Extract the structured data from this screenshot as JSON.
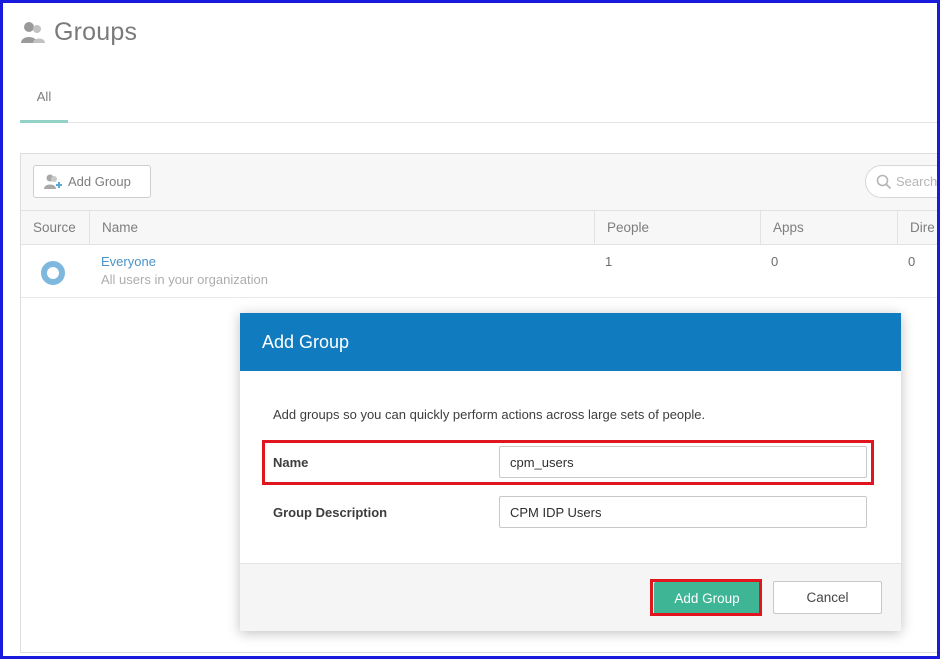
{
  "header": {
    "title": "Groups",
    "icon": "group-icon"
  },
  "tabs": [
    {
      "label": "All",
      "active": true
    }
  ],
  "toolbar": {
    "add_group_label": "Add Group",
    "search_placeholder": "Search"
  },
  "table": {
    "columns": [
      "Source",
      "Name",
      "People",
      "Apps",
      "Dire"
    ],
    "rows": [
      {
        "source_icon": "okta-ring-icon",
        "name": "Everyone",
        "description": "All users in your organization",
        "people": "1",
        "apps": "0",
        "directories": "0"
      }
    ]
  },
  "modal": {
    "title": "Add Group",
    "intro": "Add groups so you can quickly perform actions across large sets of people.",
    "name_label": "Name",
    "name_value": "cpm_users",
    "description_label": "Group Description",
    "description_value": "CPM IDP Users",
    "submit_label": "Add Group",
    "cancel_label": "Cancel"
  },
  "colors": {
    "modal_header": "#117bc0",
    "primary_button": "#3eb594",
    "highlight": "#e0151e",
    "link": "#4a93c8",
    "frame": "#1a1adc"
  }
}
